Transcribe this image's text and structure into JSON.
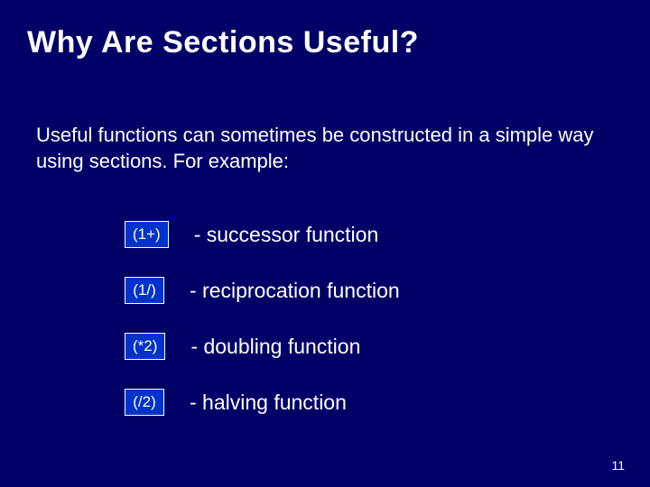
{
  "title": "Why Are Sections Useful?",
  "intro": "Useful functions can sometimes be constructed in a simple way using sections.  For example:",
  "items": [
    {
      "code": "(1+)",
      "desc": "- successor function"
    },
    {
      "code": "(1/)",
      "desc": "- reciprocation function"
    },
    {
      "code": "(*2)",
      "desc": "- doubling function"
    },
    {
      "code": "(/2)",
      "desc": "- halving function"
    }
  ],
  "slide_number": "11"
}
